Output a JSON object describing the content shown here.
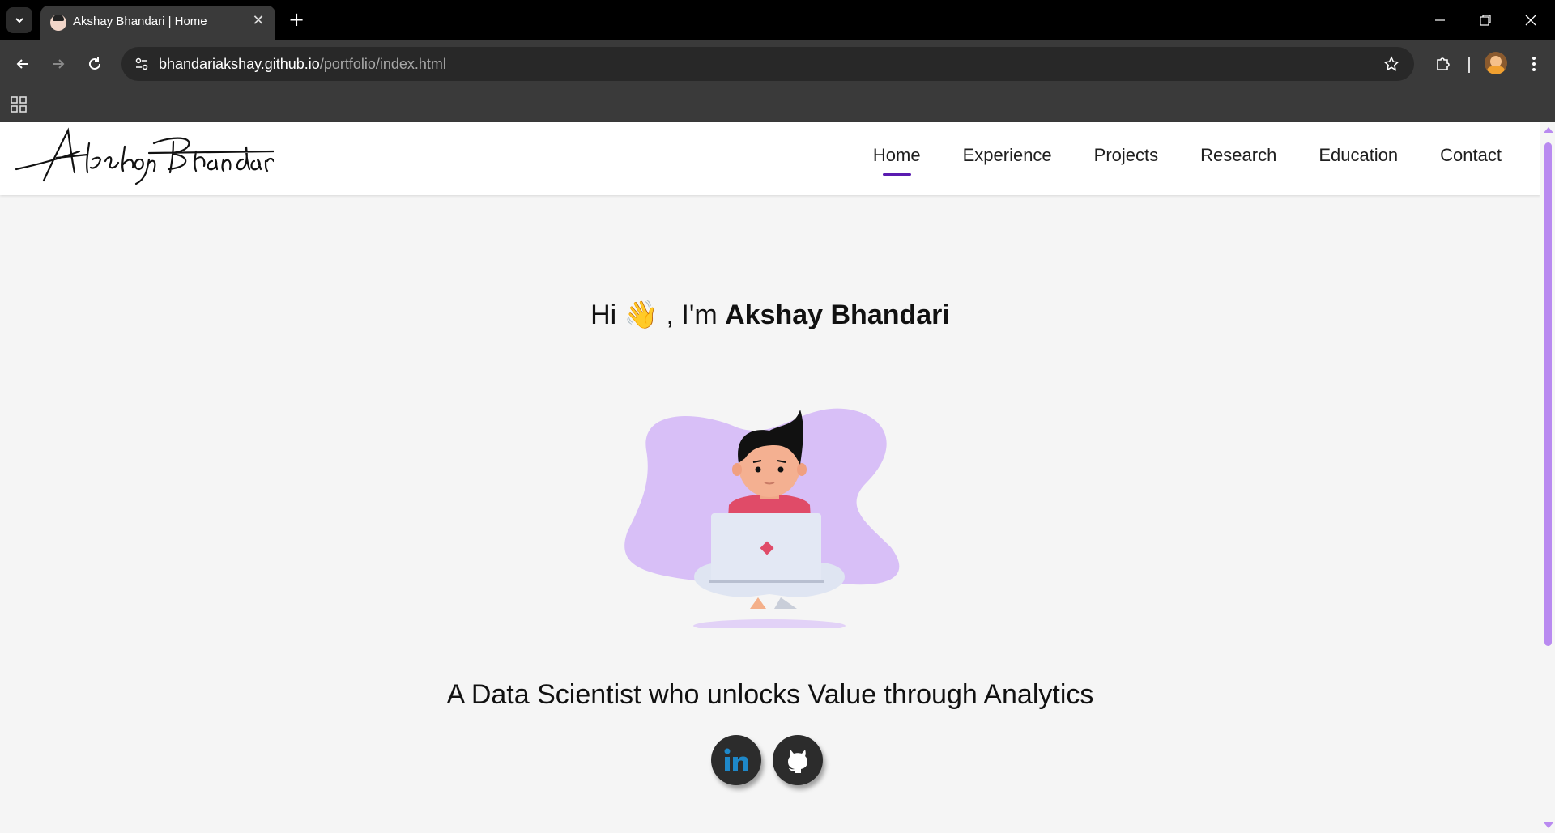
{
  "browser": {
    "tab_title": "Akshay Bhandari | Home",
    "url_host": "bhandariakshay.github.io",
    "url_path": "/portfolio/index.html"
  },
  "site": {
    "logo_text": "Akshay Bhandari",
    "nav": [
      {
        "label": "Home",
        "active": true
      },
      {
        "label": "Experience",
        "active": false
      },
      {
        "label": "Projects",
        "active": false
      },
      {
        "label": "Research",
        "active": false
      },
      {
        "label": "Education",
        "active": false
      },
      {
        "label": "Contact",
        "active": false
      }
    ],
    "accent_color": "#5a1bb0"
  },
  "hero": {
    "greeting_prefix": "Hi",
    "wave_emoji": "👋",
    "greeting_middle": ", I'm",
    "name": "Akshay Bhandari",
    "tagline": "A Data Scientist who unlocks Value through Analytics"
  },
  "socials": [
    {
      "name": "LinkedIn",
      "icon": "linkedin-icon"
    },
    {
      "name": "GitHub",
      "icon": "github-icon"
    }
  ]
}
